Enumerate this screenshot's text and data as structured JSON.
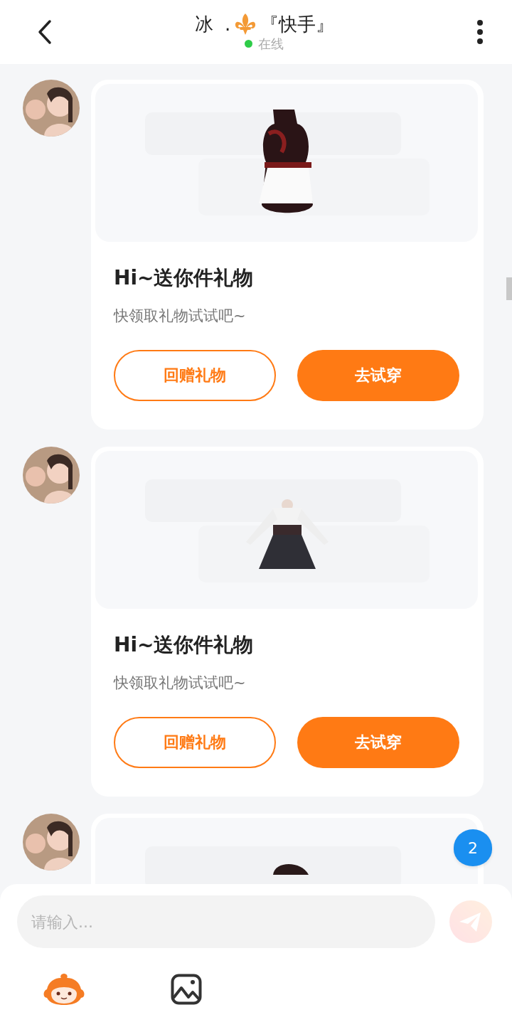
{
  "header": {
    "title_prefix": "冰  .",
    "title_suffix": "『快手』",
    "status": {
      "online": true,
      "label": "在线"
    }
  },
  "messages": [
    {
      "kind": "gift",
      "title": "Hi~送你件礼物",
      "subtitle": "快领取礼物试试吧~",
      "buttons": [
        {
          "label": "回赠礼物",
          "kind": "outline"
        },
        {
          "label": "去试穿",
          "kind": "filled"
        }
      ]
    },
    {
      "kind": "gift",
      "title": "Hi~送你件礼物",
      "subtitle": "快领取礼物试试吧~",
      "buttons": [
        {
          "label": "回赠礼物",
          "kind": "outline"
        },
        {
          "label": "去试穿",
          "kind": "filled"
        }
      ]
    },
    {
      "kind": "partial"
    }
  ],
  "unread_badge": "2",
  "composer": {
    "placeholder": "请输入...",
    "send_disabled": true
  }
}
